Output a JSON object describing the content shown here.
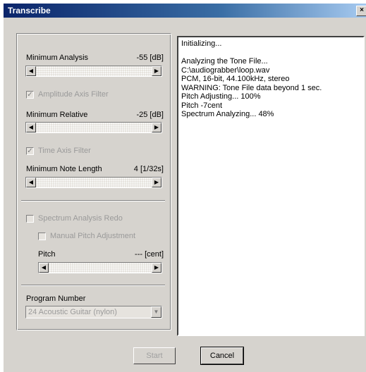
{
  "window": {
    "title": "Transcribe",
    "close_glyph": "×"
  },
  "settings": {
    "min_analysis": {
      "label": "Minimum Analysis",
      "value": "-55 [dB]"
    },
    "amplitude_filter": {
      "label": "Amplitude Axis Filter",
      "checked": true
    },
    "min_relative": {
      "label": "Minimum Relative",
      "value": "-25 [dB]"
    },
    "time_filter": {
      "label": "Time Axis Filter",
      "checked": true
    },
    "min_note_length": {
      "label": "Minimum Note Length",
      "value": "4 [1/32s]"
    },
    "spectrum_redo": {
      "label": "Spectrum Analysis Redo",
      "checked": false
    },
    "manual_pitch": {
      "label": "Manual Pitch Adjustment",
      "checked": false
    },
    "pitch": {
      "label": "Pitch",
      "value": "--- [cent]"
    },
    "program_number": {
      "label": "Program Number",
      "selected": "24 Acoustic Guitar (nylon)"
    }
  },
  "scroll": {
    "left": "◀",
    "right": "▶",
    "down": "▼"
  },
  "log": {
    "lines": [
      "Initializing...",
      "",
      "Analyzing the Tone File...",
      "C:\\audiograbber\\loop.wav",
      "PCM, 16-bit, 44.100kHz, stereo",
      "WARNING: Tone File data beyond 1 sec.",
      "Pitch Adjusting... 100%",
      "Pitch  -7cent",
      "Spectrum Analyzing...  48%"
    ]
  },
  "buttons": {
    "start": "Start",
    "cancel": "Cancel"
  }
}
